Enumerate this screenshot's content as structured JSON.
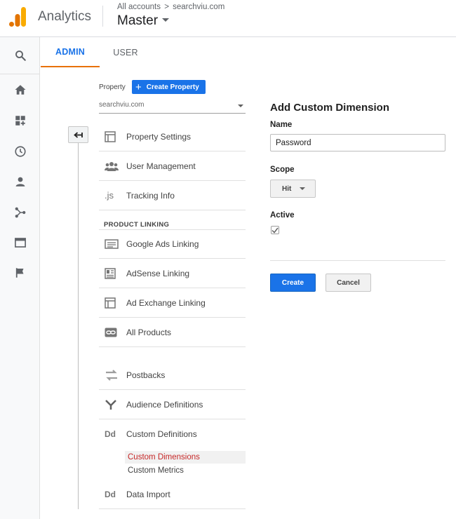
{
  "header": {
    "app_name": "Analytics",
    "breadcrumb_root": "All accounts",
    "breadcrumb_sep": ">",
    "breadcrumb_account": "searchviu.com",
    "view_name": "Master"
  },
  "leftnav": {
    "icons": [
      "search-icon",
      "home-icon",
      "customization-icon",
      "realtime-clock-icon",
      "audience-person-icon",
      "acquisition-icon",
      "behavior-icon",
      "conversions-flag-icon"
    ]
  },
  "tabs": {
    "admin": "ADMIN",
    "user": "USER"
  },
  "property": {
    "label": "Property",
    "create_button": "Create Property",
    "selected": "searchviu.com"
  },
  "menu": {
    "property_settings": "Property Settings",
    "user_management": "User Management",
    "tracking_icon_text": ".js",
    "tracking_info": "Tracking Info",
    "product_linking_header": "PRODUCT LINKING",
    "google_ads_linking": "Google Ads Linking",
    "adsense_linking": "AdSense Linking",
    "ad_exchange_linking": "Ad Exchange Linking",
    "all_products": "All Products",
    "postbacks": "Postbacks",
    "audience_definitions": "Audience Definitions",
    "custom_definitions_icon_text": "Dd",
    "custom_definitions": "Custom Definitions",
    "custom_dimensions": "Custom Dimensions",
    "custom_metrics": "Custom Metrics",
    "data_import_icon_text": "Dd",
    "data_import": "Data Import"
  },
  "form": {
    "title": "Add Custom Dimension",
    "name_label": "Name",
    "name_value": "Password",
    "scope_label": "Scope",
    "scope_value": "Hit",
    "active_label": "Active",
    "active_checked": true,
    "create_button": "Create",
    "cancel_button": "Cancel"
  },
  "colors": {
    "accent_blue": "#1a73e8",
    "active_tab_underline": "#e8710a",
    "active_subitem": "#c62828",
    "logo_orange": "#f9ab00",
    "logo_dark_orange": "#e37400"
  }
}
